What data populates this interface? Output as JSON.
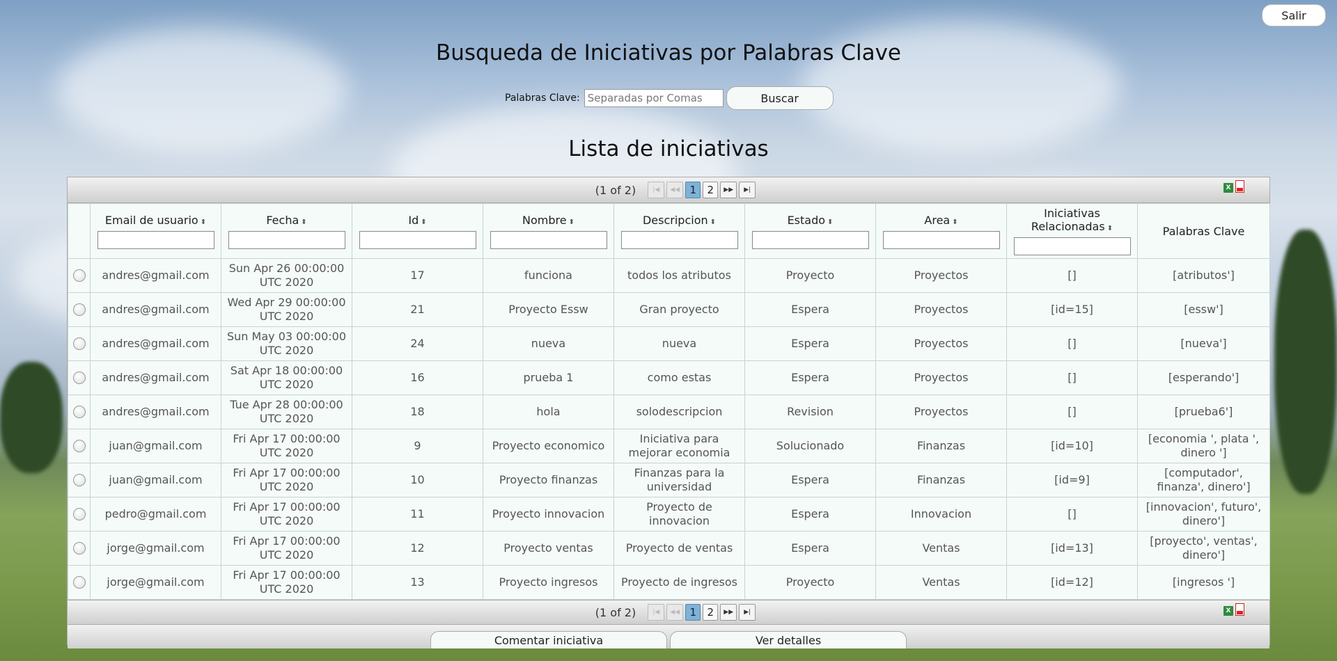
{
  "header": {
    "logout_label": "Salir"
  },
  "page": {
    "title": "Busqueda de Iniciativas por Palabras Clave"
  },
  "search": {
    "label": "Palabras Clave:",
    "placeholder": "Separadas por Comas",
    "value": "",
    "button_label": "Buscar"
  },
  "list": {
    "title": "Lista de iniciativas"
  },
  "paginator": {
    "text": "(1 of 2)",
    "pages": [
      "1",
      "2"
    ],
    "current_page": "1"
  },
  "exports": {
    "excel_icon": "excel-icon",
    "pdf_icon": "pdf-icon"
  },
  "table": {
    "columns": [
      {
        "label": "Email de usuario",
        "sortable": true,
        "filter": true
      },
      {
        "label": "Fecha",
        "sortable": true,
        "filter": true
      },
      {
        "label": "Id",
        "sortable": true,
        "filter": true
      },
      {
        "label": "Nombre",
        "sortable": true,
        "filter": true
      },
      {
        "label": "Descripcion",
        "sortable": true,
        "filter": true
      },
      {
        "label": "Estado",
        "sortable": true,
        "filter": true
      },
      {
        "label": "Area",
        "sortable": true,
        "filter": true
      },
      {
        "label": "Iniciativas Relacionadas",
        "sortable": true,
        "filter": true
      },
      {
        "label": "Palabras Clave",
        "sortable": false,
        "filter": false
      }
    ],
    "rows": [
      [
        "andres@gmail.com",
        "Sun Apr 26 00:00:00 UTC 2020",
        "17",
        "funciona",
        "todos los atributos",
        "Proyecto",
        "Proyectos",
        "[]",
        "[atributos']"
      ],
      [
        "andres@gmail.com",
        "Wed Apr 29 00:00:00 UTC 2020",
        "21",
        "Proyecto Essw",
        "Gran proyecto",
        "Espera",
        "Proyectos",
        "[id=15]",
        "[essw']"
      ],
      [
        "andres@gmail.com",
        "Sun May 03 00:00:00 UTC 2020",
        "24",
        "nueva",
        "nueva",
        "Espera",
        "Proyectos",
        "[]",
        "[nueva']"
      ],
      [
        "andres@gmail.com",
        "Sat Apr 18 00:00:00 UTC 2020",
        "16",
        "prueba 1",
        "como estas",
        "Espera",
        "Proyectos",
        "[]",
        "[esperando']"
      ],
      [
        "andres@gmail.com",
        "Tue Apr 28 00:00:00 UTC 2020",
        "18",
        "hola",
        "solodescripcion",
        "Revision",
        "Proyectos",
        "[]",
        "[prueba6']"
      ],
      [
        "juan@gmail.com",
        "Fri Apr 17 00:00:00 UTC 2020",
        "9",
        "Proyecto economico",
        "Iniciativa para mejorar economia",
        "Solucionado",
        "Finanzas",
        "[id=10]",
        "[economia ', plata ', dinero ']"
      ],
      [
        "juan@gmail.com",
        "Fri Apr 17 00:00:00 UTC 2020",
        "10",
        "Proyecto finanzas",
        "Finanzas para la universidad",
        "Espera",
        "Finanzas",
        "[id=9]",
        "[computador', finanza', dinero']"
      ],
      [
        "pedro@gmail.com",
        "Fri Apr 17 00:00:00 UTC 2020",
        "11",
        "Proyecto innovacion",
        "Proyecto de innovacion",
        "Espera",
        "Innovacion",
        "[]",
        "[innovacion', futuro', dinero']"
      ],
      [
        "jorge@gmail.com",
        "Fri Apr 17 00:00:00 UTC 2020",
        "12",
        "Proyecto ventas",
        "Proyecto de ventas",
        "Espera",
        "Ventas",
        "[id=13]",
        "[proyecto', ventas', dinero']"
      ],
      [
        "jorge@gmail.com",
        "Fri Apr 17 00:00:00 UTC 2020",
        "13",
        "Proyecto ingresos",
        "Proyecto de ingresos",
        "Proyecto",
        "Ventas",
        "[id=12]",
        "[ingresos ']"
      ]
    ]
  },
  "actions": {
    "comment_label": "Comentar iniciativa",
    "details_label": "Ver detalles"
  }
}
